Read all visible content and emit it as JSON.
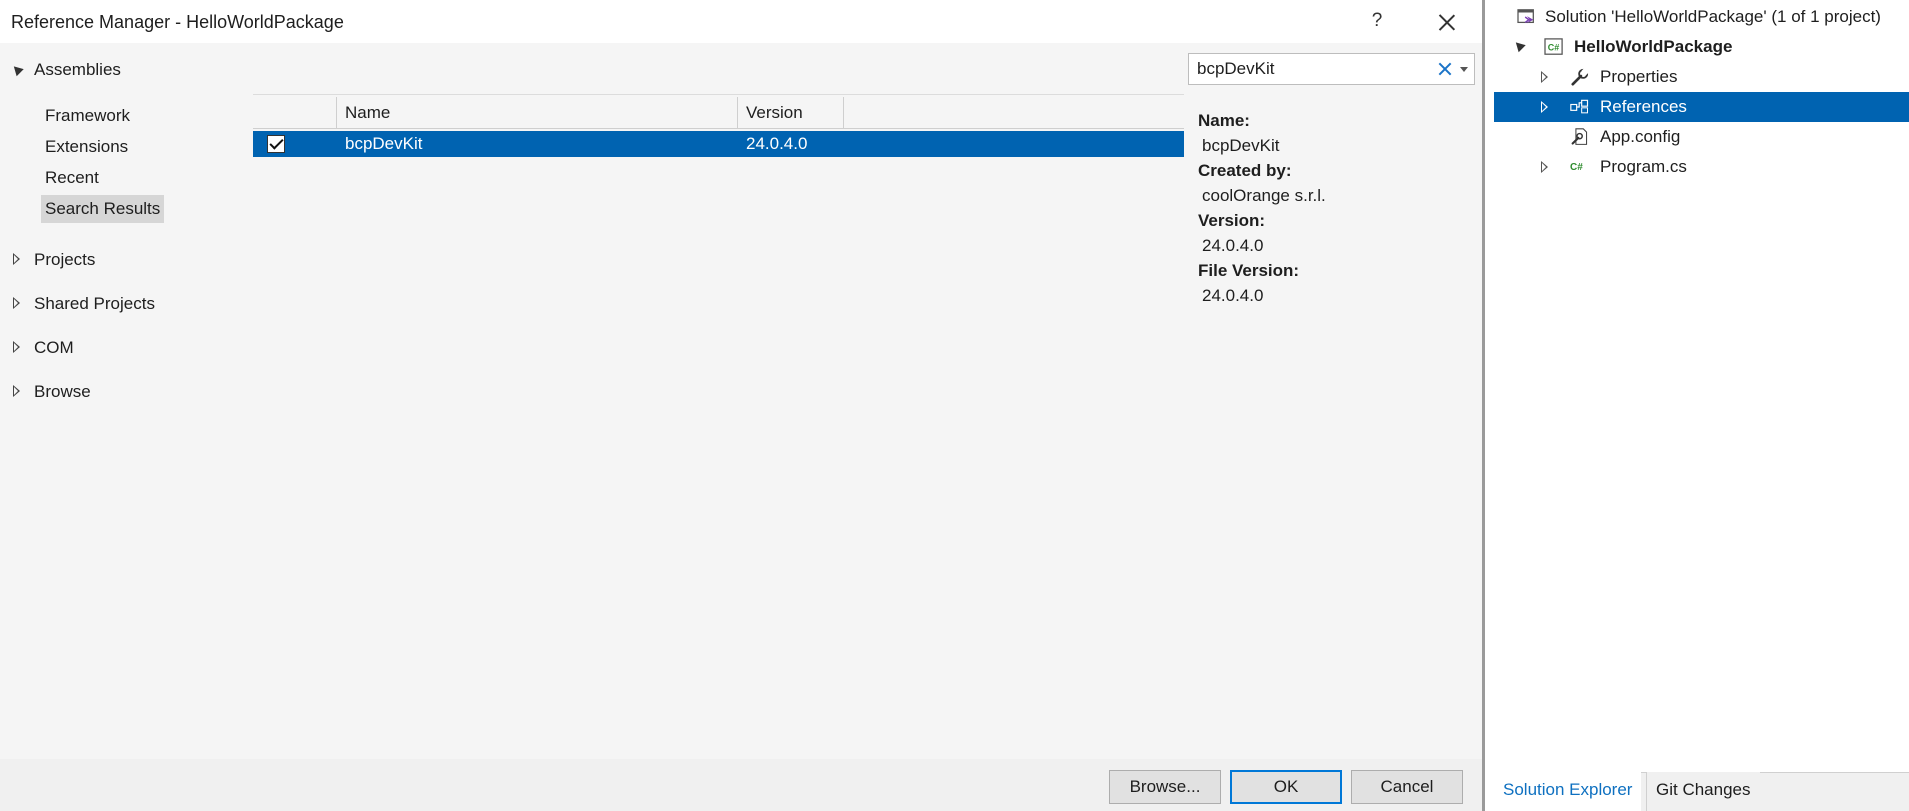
{
  "dialog": {
    "title": "Reference Manager - HelloWorldPackage",
    "help_label": "?",
    "nav": {
      "assemblies_label": "Assemblies",
      "assemblies_children": [
        "Framework",
        "Extensions",
        "Recent",
        "Search Results"
      ],
      "selected_child": "Search Results",
      "sections": [
        "Projects",
        "Shared Projects",
        "COM",
        "Browse"
      ]
    },
    "list": {
      "columns": [
        "Name",
        "Version"
      ],
      "rows": [
        {
          "checked": true,
          "name": "bcpDevKit",
          "version": "24.0.4.0",
          "selected": true
        }
      ]
    },
    "search": {
      "value": "bcpDevKit"
    },
    "details": {
      "name_label": "Name:",
      "name_value": "bcpDevKit",
      "created_label": "Created by:",
      "created_value": "coolOrange s.r.l.",
      "version_label": "Version:",
      "version_value": "24.0.4.0",
      "file_version_label": "File Version:",
      "file_version_value": "24.0.4.0"
    },
    "buttons": {
      "browse": "Browse...",
      "ok": "OK",
      "cancel": "Cancel"
    }
  },
  "solution_explorer": {
    "solution_label": "Solution 'HelloWorldPackage' (1 of 1 project)",
    "project_label": "HelloWorldPackage",
    "items": [
      "Properties",
      "References",
      "App.config",
      "Program.cs"
    ],
    "selected_item": "References",
    "tabs": [
      "Solution Explorer",
      "Git Changes"
    ],
    "active_tab": "Solution Explorer"
  },
  "colors": {
    "selection": "#0063b1",
    "accent": "#0078d7",
    "tab_active_text": "#0e70c0"
  }
}
